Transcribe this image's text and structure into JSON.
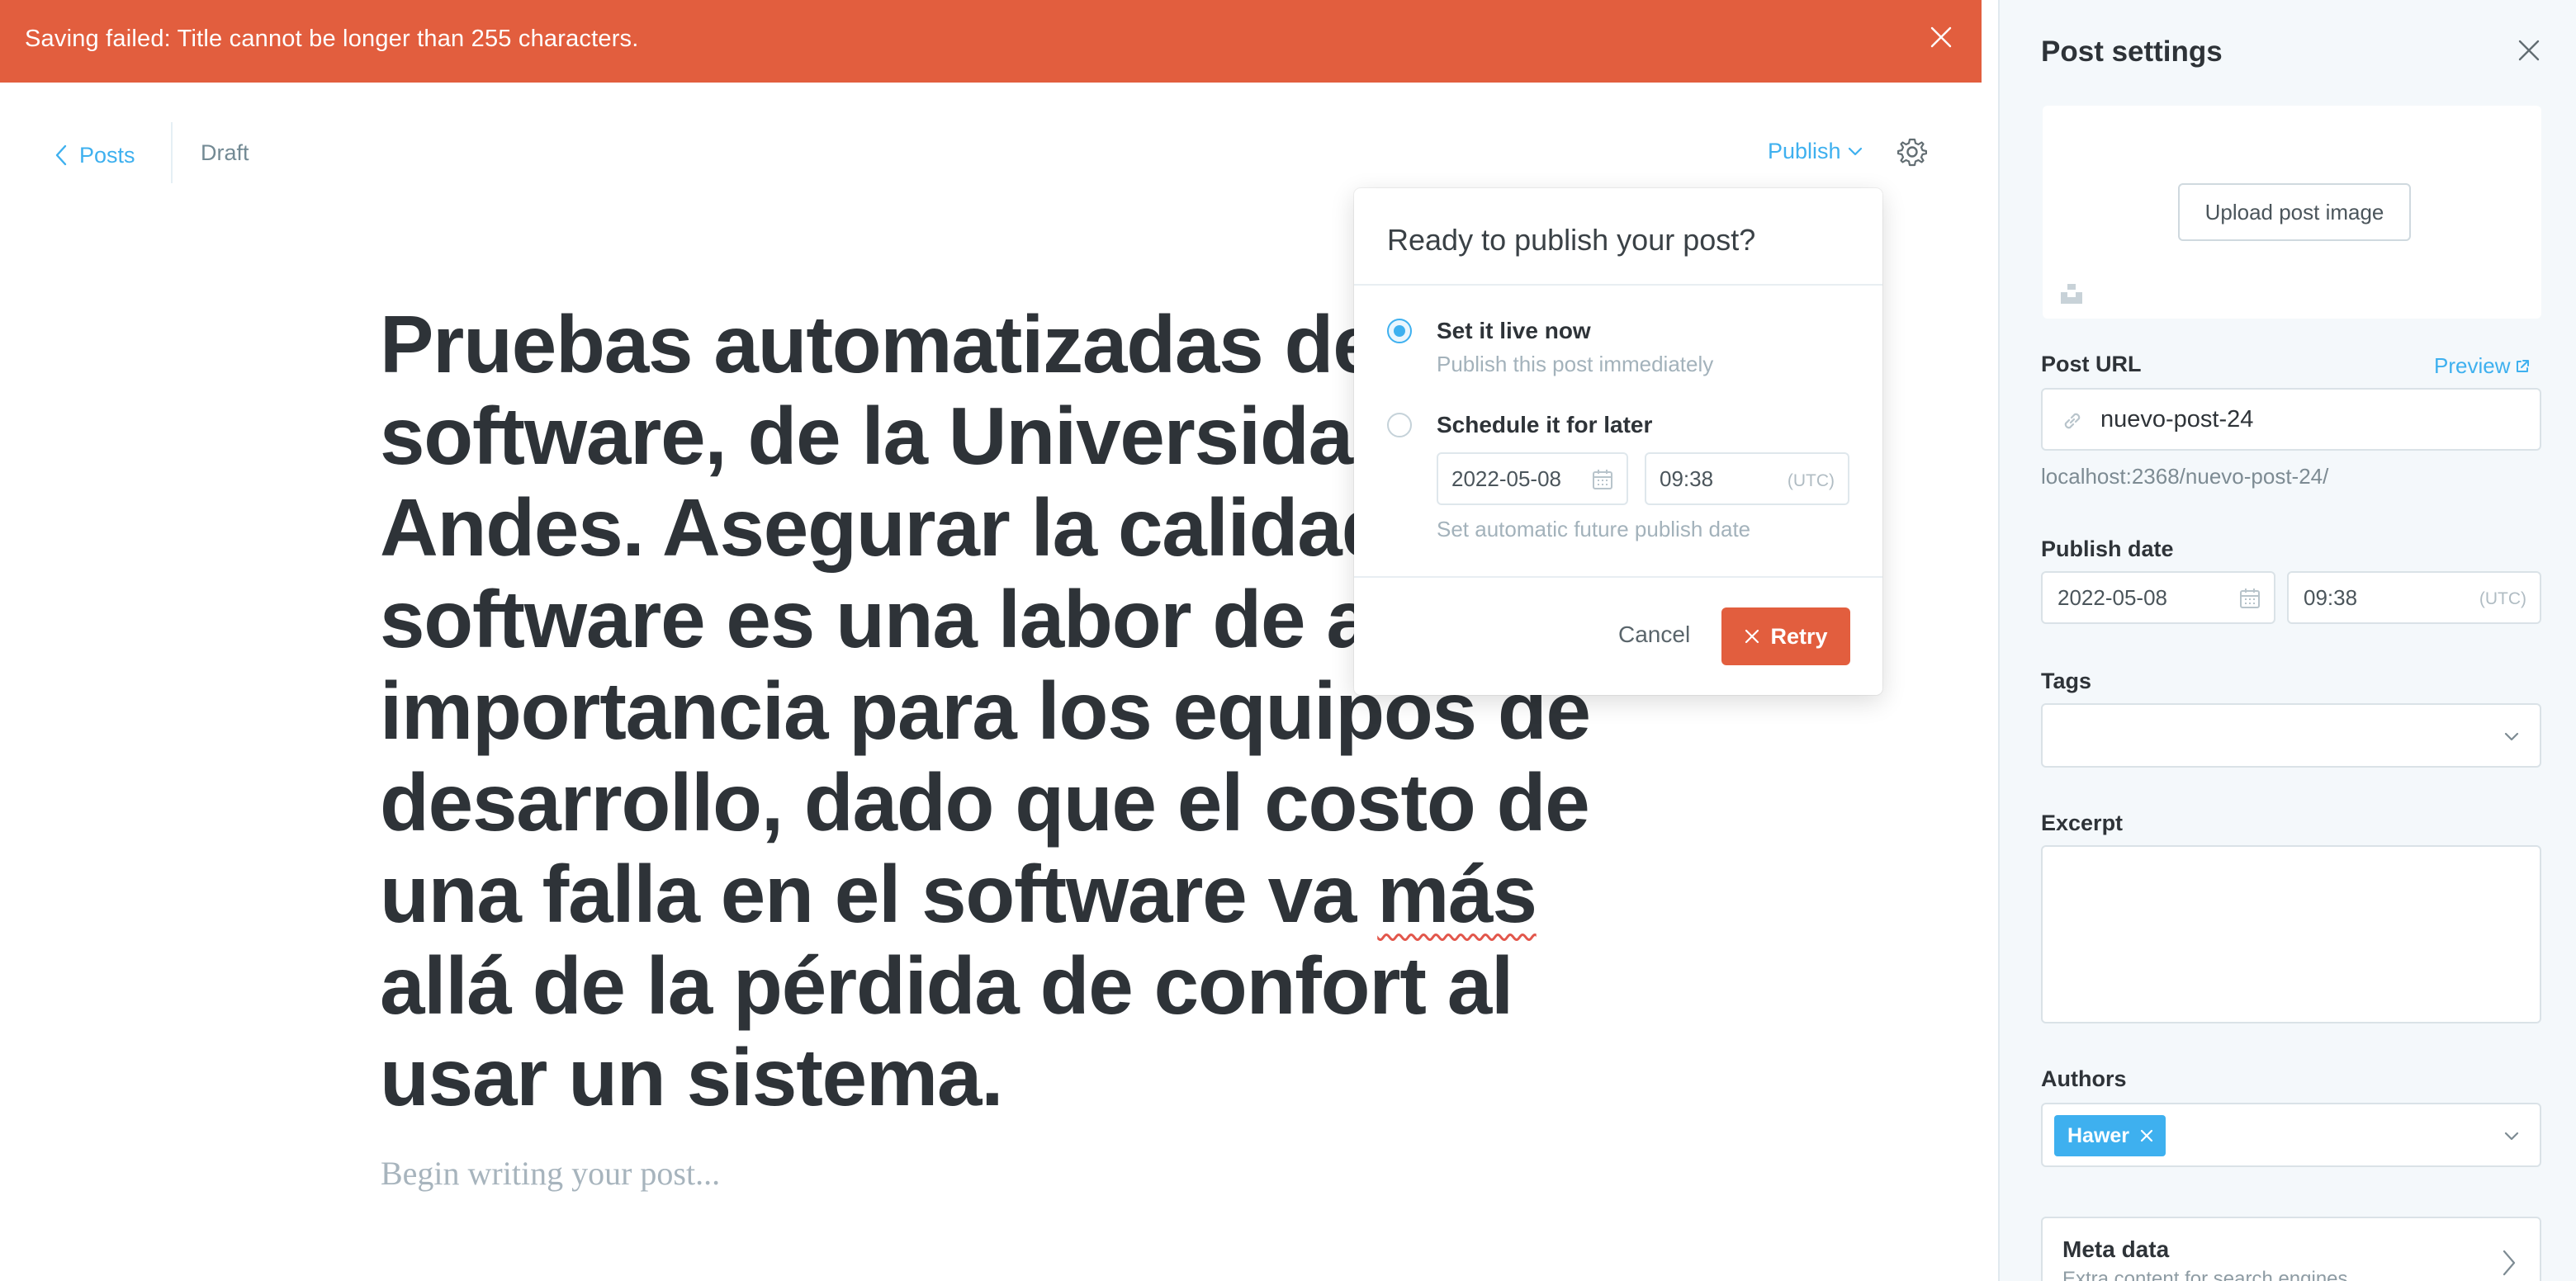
{
  "alert": {
    "message": "Saving failed: Title cannot be longer than 255 characters.",
    "color": "#e25e3e",
    "close_icon": "close-icon"
  },
  "header": {
    "back_label": "Posts",
    "status": "Draft",
    "publish_label": "Publish",
    "settings_icon": "gear-icon"
  },
  "editor": {
    "title_before": "Pruebas automatizadas de software, de la Universidad de los Andes. Asegurar la calidad del software es una labor de alta importancia para los equipos de desarrollo, dado que el costo de una falla en el software va ",
    "title_flagged_word": "más",
    "title_after": " allá de la pérdida de confort al usar un sistema.",
    "body_placeholder": "Begin writing your post..."
  },
  "publish_menu": {
    "heading": "Ready to publish your post?",
    "options": [
      {
        "label": "Set it live now",
        "description": "Publish this post immediately",
        "selected": true
      },
      {
        "label": "Schedule it for later",
        "description": "Set automatic future publish date",
        "selected": false
      }
    ],
    "schedule_date": "2022-05-08",
    "schedule_time": "09:38",
    "timezone": "(UTC)",
    "cancel_label": "Cancel",
    "retry_label": "Retry"
  },
  "sidebar": {
    "title": "Post settings",
    "upload_label": "Upload post image",
    "post_url_label": "Post URL",
    "preview_label": "Preview",
    "slug": "nuevo-post-24",
    "full_url": "localhost:2368/nuevo-post-24/",
    "publish_date_label": "Publish date",
    "publish_date": "2022-05-08",
    "publish_time": "09:38",
    "timezone": "(UTC)",
    "tags_label": "Tags",
    "excerpt_label": "Excerpt",
    "authors_label": "Authors",
    "authors": [
      "Hawer"
    ],
    "meta_title": "Meta data",
    "meta_subtitle": "Extra content for search engines"
  },
  "colors": {
    "accent": "#3eb0ef",
    "danger": "#e25e3e",
    "text": "#2e3338"
  }
}
